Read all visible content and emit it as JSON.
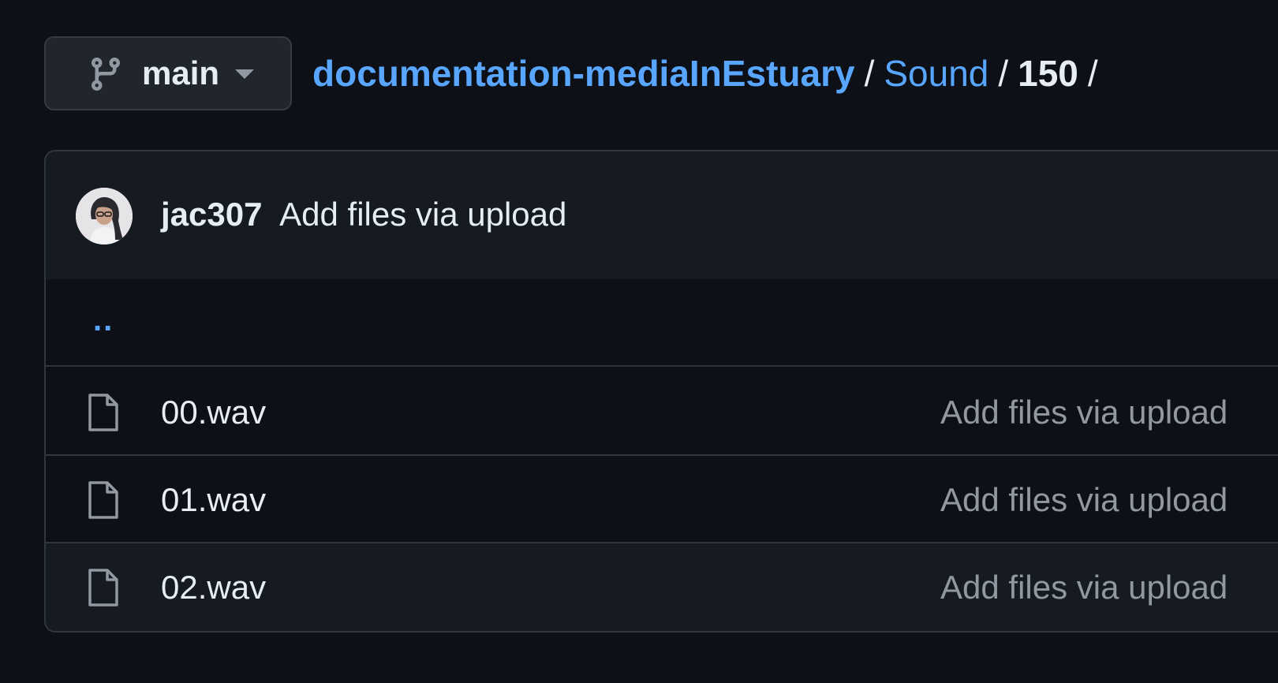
{
  "branch": {
    "label": "main",
    "icon": "git-branch-icon"
  },
  "breadcrumb": {
    "repo": "documentation-mediaInEstuary",
    "folder": "Sound",
    "current": "150",
    "separator": "/"
  },
  "commit": {
    "author": "jac307",
    "message": "Add files via upload"
  },
  "parent_dir": "..",
  "files": [
    {
      "name": "00.wav",
      "commit_message": "Add files via upload",
      "icon": "file-icon"
    },
    {
      "name": "01.wav",
      "commit_message": "Add files via upload",
      "icon": "file-icon"
    },
    {
      "name": "02.wav",
      "commit_message": "Add files via upload",
      "icon": "file-icon"
    }
  ],
  "colors": {
    "background": "#0d1117",
    "link": "#58a6ff",
    "muted_text": "#9198a1",
    "border": "#30363d"
  }
}
